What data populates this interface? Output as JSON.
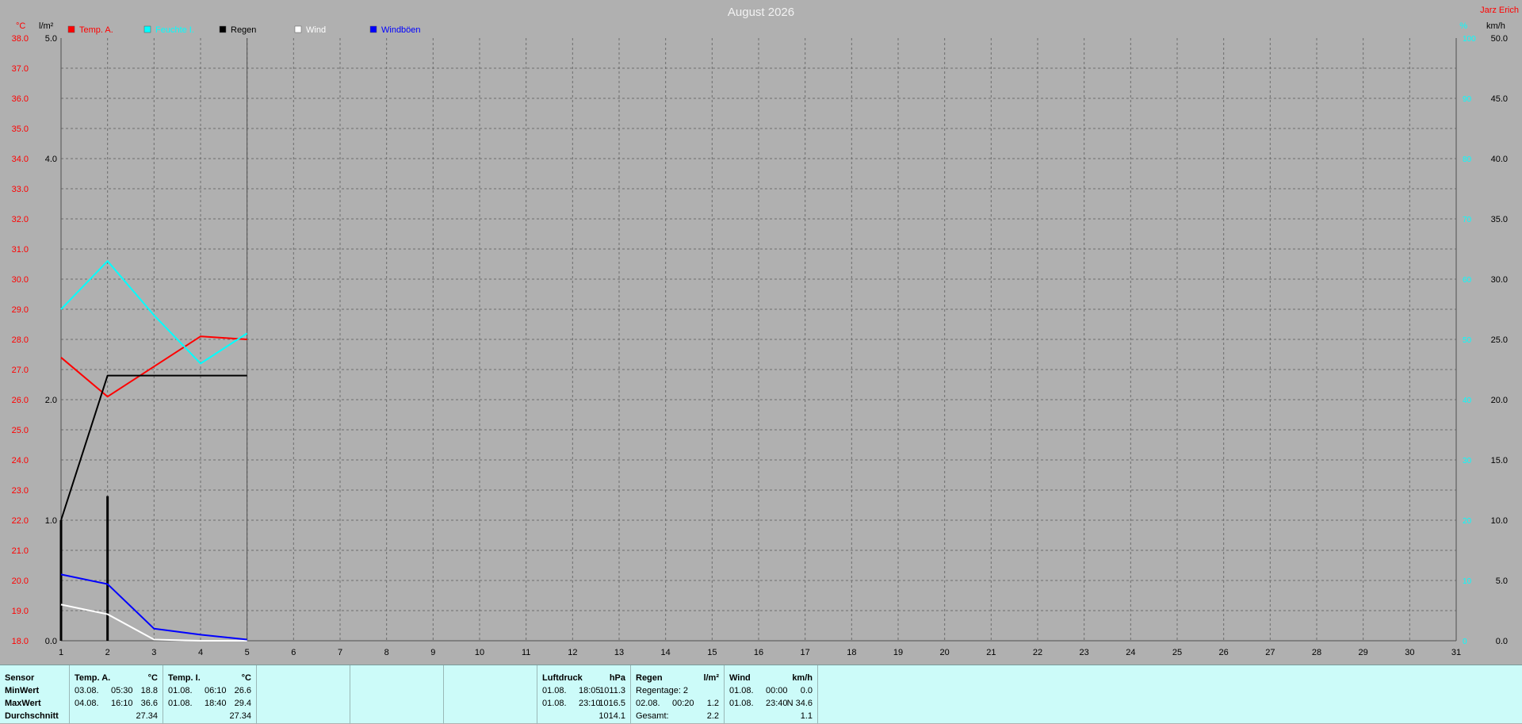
{
  "chart_data": {
    "type": "line",
    "title": "August 2026",
    "author": "Jarz Erich",
    "x": [
      1,
      2,
      3,
      4,
      5
    ],
    "xlim": [
      1,
      31
    ],
    "x_ticks": [
      1,
      2,
      3,
      4,
      5,
      6,
      7,
      8,
      9,
      10,
      11,
      12,
      13,
      14,
      15,
      16,
      17,
      18,
      19,
      20,
      21,
      22,
      23,
      24,
      25,
      26,
      27,
      28,
      29,
      30,
      31
    ],
    "axes": {
      "temp": {
        "unit": "°C",
        "range": [
          18,
          38
        ],
        "ticks": [
          "18.0",
          "19.0",
          "20.0",
          "21.0",
          "22.0",
          "23.0",
          "24.0",
          "25.0",
          "26.0",
          "27.0",
          "28.0",
          "29.0",
          "30.0",
          "31.0",
          "32.0",
          "33.0",
          "34.0",
          "35.0",
          "36.0",
          "37.0",
          "38.0"
        ],
        "color": "#ff0000"
      },
      "rain": {
        "unit": "l/m²",
        "range": [
          0,
          5
        ],
        "ticks": [
          "0.0",
          "1.0",
          "2.0",
          "4.0",
          "5.0"
        ],
        "color": "#000000"
      },
      "humidity": {
        "unit": "%",
        "range": [
          0,
          100
        ],
        "ticks": [
          "0",
          "10",
          "20",
          "30",
          "40",
          "50",
          "60",
          "70",
          "80",
          "90",
          "100"
        ],
        "color": "#00ffff"
      },
      "wind": {
        "unit": "km/h",
        "range": [
          0,
          50
        ],
        "ticks": [
          "0.0",
          "5.0",
          "10.0",
          "15.0",
          "20.0",
          "25.0",
          "30.0",
          "35.0",
          "40.0",
          "45.0",
          "50.0"
        ],
        "color": "#000000"
      }
    },
    "grid": true,
    "legend": [
      {
        "label": "Temp. A.",
        "color": "#ff0000"
      },
      {
        "label": "Feuchte I.",
        "color": "#00ffff"
      },
      {
        "label": "Regen",
        "color": "#000000"
      },
      {
        "label": "Wind",
        "color": "#ffffff"
      },
      {
        "label": "Windböen",
        "color": "#0000ff"
      }
    ],
    "series": [
      {
        "name": "Temp. A.",
        "axis": "temp",
        "color": "#ff0000",
        "values": [
          27.4,
          26.1,
          27.1,
          28.1,
          28.0
        ]
      },
      {
        "name": "Feuchte I.",
        "axis": "humidity",
        "color": "#00ffff",
        "values": [
          55,
          63,
          54,
          46,
          51
        ]
      },
      {
        "name": "Regen",
        "axis": "rain",
        "color": "#000000",
        "values": [
          1.0,
          2.2,
          2.2,
          2.2,
          2.2
        ]
      },
      {
        "name": "Wind",
        "axis": "wind",
        "color": "#ffffff",
        "values": [
          3.0,
          2.2,
          0.1,
          0.0,
          0.0
        ]
      },
      {
        "name": "Windböen",
        "axis": "wind",
        "color": "#0000ff",
        "values": [
          5.5,
          4.7,
          1.0,
          0.5,
          0.1
        ]
      }
    ],
    "daily_rain": {
      "axis": "rain",
      "color": "#000000",
      "bars": [
        {
          "x": 1,
          "value": 1.0
        },
        {
          "x": 2,
          "value": 1.2
        }
      ]
    }
  },
  "stats": {
    "labels": {
      "header": "Sensor",
      "min": "MinWert",
      "max": "MaxWert",
      "avg": "Durchschnitt"
    },
    "temp_a": {
      "title": "Temp. A.",
      "unit": "°C",
      "min": {
        "date": "03.08.",
        "time": "05:30",
        "value": "18.8"
      },
      "max": {
        "date": "04.08.",
        "time": "16:10",
        "value": "36.6"
      },
      "avg": "27.34"
    },
    "temp_i": {
      "title": "Temp. I.",
      "unit": "°C",
      "min": {
        "date": "01.08.",
        "time": "06:10",
        "value": "26.6"
      },
      "max": {
        "date": "01.08.",
        "time": "18:40",
        "value": "29.4"
      },
      "avg": "27.34"
    },
    "pressure": {
      "title": "Luftdruck",
      "unit": "hPa",
      "min": {
        "date": "01.08.",
        "time": "18:05",
        "value": "1011.3"
      },
      "max": {
        "date": "01.08.",
        "time": "23:10",
        "value": "1016.5"
      },
      "avg": "1014.1"
    },
    "rain": {
      "title": "Regen",
      "unit": "l/m²",
      "days_label": "Regentage: 2",
      "max": {
        "date": "02.08.",
        "time": "00:20",
        "value": "1.2"
      },
      "total_label": "Gesamt:",
      "total": "2.2"
    },
    "wind": {
      "title": "Wind",
      "unit": "km/h",
      "min": {
        "date": "01.08.",
        "time": "00:00",
        "value": "0.0"
      },
      "max": {
        "date": "01.08.",
        "time": "23:40",
        "value": "N 34.6"
      },
      "avg": "1.1"
    }
  }
}
